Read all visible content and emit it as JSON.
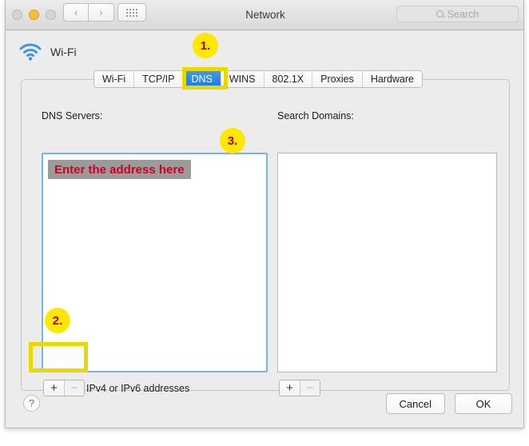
{
  "window": {
    "title": "Network",
    "traffic_lights": [
      "close",
      "minimize",
      "zoom"
    ],
    "nav": {
      "back": "‹",
      "forward": "›"
    },
    "grid_button": "all-preferences-grid"
  },
  "search": {
    "placeholder": "Search",
    "value": "",
    "icon": "search-icon"
  },
  "service": {
    "name": "Wi-Fi",
    "icon": "wifi-icon"
  },
  "tabs": [
    {
      "label": "Wi-Fi",
      "selected": false
    },
    {
      "label": "TCP/IP",
      "selected": false
    },
    {
      "label": "DNS",
      "selected": true
    },
    {
      "label": "WINS",
      "selected": false
    },
    {
      "label": "802.1X",
      "selected": false
    },
    {
      "label": "Proxies",
      "selected": false
    },
    {
      "label": "Hardware",
      "selected": false
    }
  ],
  "dns_panel": {
    "servers_label": "DNS Servers:",
    "servers": [
      {
        "text": "Enter the address here",
        "selected": true
      }
    ],
    "add_label": "+",
    "remove_label": "−",
    "hint": "IPv4 or IPv6 addresses",
    "search_domains_label": "Search Domains:",
    "search_domains": [],
    "sd_add_label": "+",
    "sd_remove_label": "−"
  },
  "footer": {
    "help_label": "?",
    "cancel_label": "Cancel",
    "ok_label": "OK"
  },
  "annotations": [
    {
      "id": "1",
      "label": "1.",
      "target": "dns-tab"
    },
    {
      "id": "2",
      "label": "2.",
      "target": "add-dns-server-button"
    },
    {
      "id": "3",
      "label": "3.",
      "target": "dns-server-entry-row"
    }
  ],
  "colors": {
    "accent_blue": "#177ae5",
    "highlight_yellow": "#e8d900",
    "badge_yellow": "#ffe800",
    "badge_text_red": "#b00020",
    "entry_text_red": "#cc0022",
    "selection_gray": "#9b9b9b",
    "window_bg": "#ececec",
    "focus_ring_blue": "#78b2ea"
  }
}
